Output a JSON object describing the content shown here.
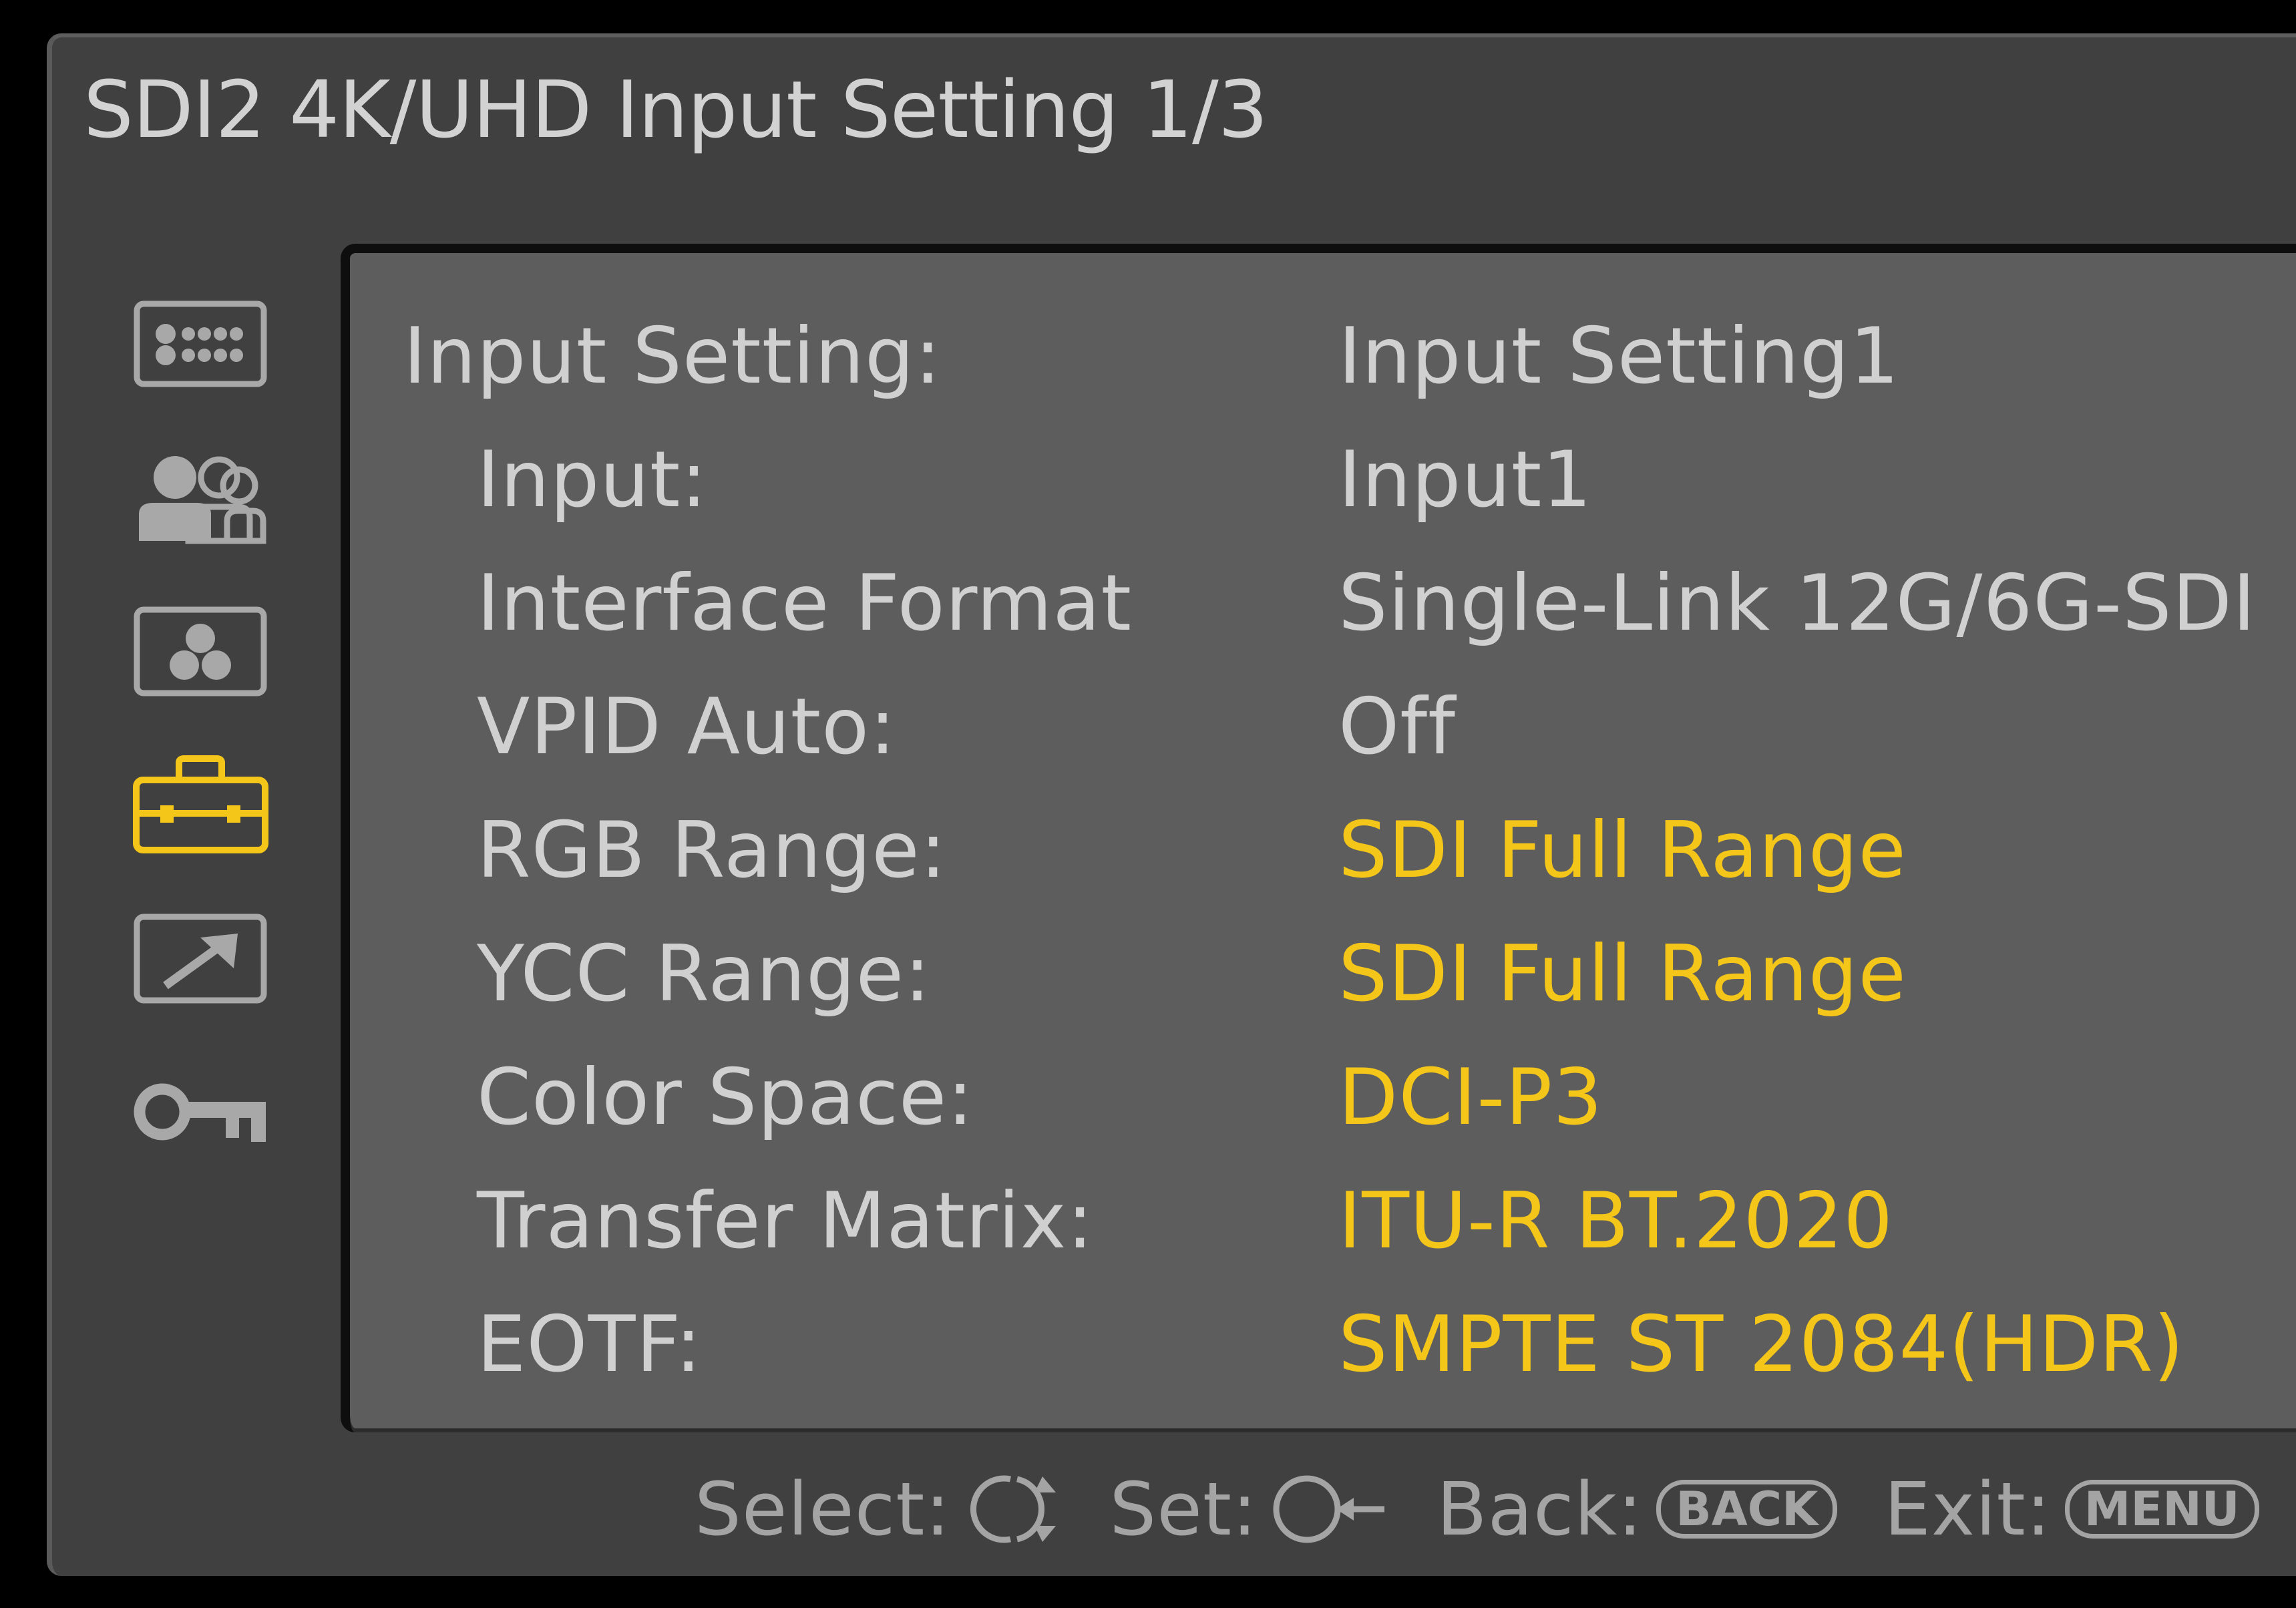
{
  "title": "SDI2 4K/UHD Input Setting 1/3",
  "sidebar": {
    "icons": [
      {
        "name": "status-icon",
        "active": false
      },
      {
        "name": "users-icon",
        "active": false
      },
      {
        "name": "color-icon",
        "active": false
      },
      {
        "name": "toolbox-icon",
        "active": true
      },
      {
        "name": "arrow-icon",
        "active": false
      },
      {
        "name": "key-icon",
        "active": false
      }
    ]
  },
  "settings": [
    {
      "label": "Input Setting:",
      "value": "Input Setting1",
      "highlight": false
    },
    {
      "label": "Input:",
      "value": "Input1",
      "highlight": false
    },
    {
      "label": "Interface Format",
      "value": "Single-Link 12G/6G-SDI",
      "highlight": false
    },
    {
      "label": "VPID Auto:",
      "value": "Off",
      "highlight": false
    },
    {
      "label": "RGB Range:",
      "value": "SDI Full Range",
      "highlight": true
    },
    {
      "label": "YCC Range:",
      "value": "SDI Full Range",
      "highlight": true
    },
    {
      "label": "Color Space:",
      "value": "DCI-P3",
      "highlight": true
    },
    {
      "label": "Transfer Matrix:",
      "value": "ITU-R BT.2020",
      "highlight": true
    },
    {
      "label": "EOTF:",
      "value": "SMPTE ST 2084(HDR)",
      "highlight": true
    }
  ],
  "footer": {
    "select_label": "Select:",
    "set_label": "Set:",
    "back_label": "Back:",
    "back_key": "BACK",
    "exit_label": "Exit:",
    "exit_key": "MENU"
  },
  "colors": {
    "highlight": "#f3c619",
    "text": "#d0d0d0",
    "icon": "#a8a8a8",
    "footer_text": "#a4a4a4"
  }
}
